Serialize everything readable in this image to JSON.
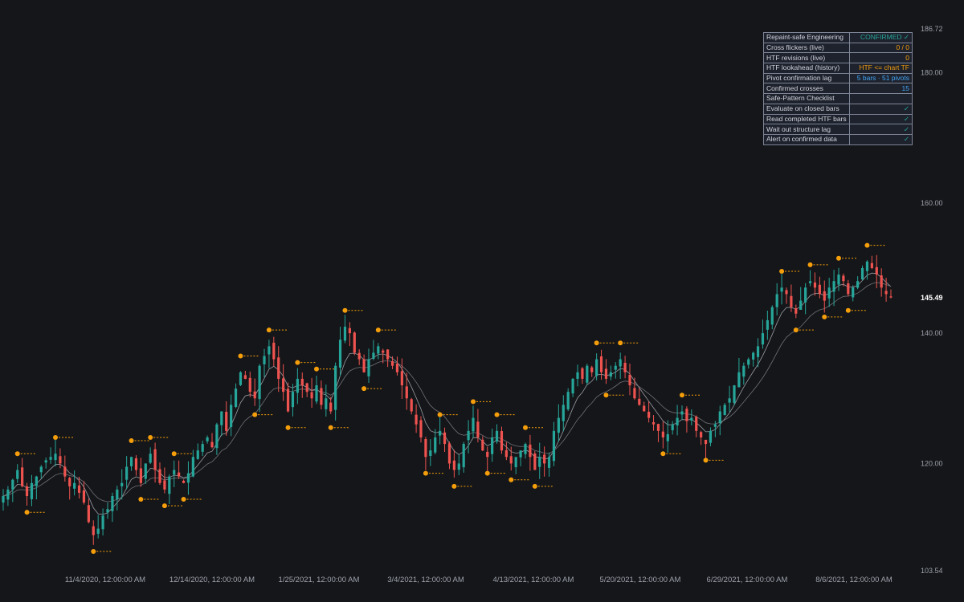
{
  "colors": {
    "background": "#151619",
    "up": "#26a69a",
    "down": "#ef5350",
    "pivot": "#f59e0b",
    "ema_fast": "#9a9ca3",
    "ema_slow": "#6f7178",
    "axis_text": "#9ba0ab",
    "last_price_text": "#ffffff"
  },
  "table": {
    "rows": [
      {
        "label": "Repaint-safe Engineering",
        "value": "CONFIRMED ✓",
        "color": "#26a69a"
      },
      {
        "label": "Cross flickers (live)",
        "value": "0 / 0",
        "color": "#f59e0b"
      },
      {
        "label": "HTF revisions (live)",
        "value": "0",
        "color": "#f59e0b"
      },
      {
        "label": "HTF lookahead (history)",
        "value": "HTF <= chart TF",
        "color": "#f59e0b"
      },
      {
        "label": "Pivot confirmation lag",
        "value": "5 bars · 51 pivots",
        "color": "#42a5f5"
      },
      {
        "label": "Confirmed crosses",
        "value": "15",
        "color": "#42a5f5"
      },
      {
        "label": "Safe-Pattern Checklist",
        "value": "",
        "color": "#d1d4dc"
      },
      {
        "label": "Evaluate on closed bars",
        "value": "✓",
        "color": "#26a69a"
      },
      {
        "label": "Read completed HTF bars",
        "value": "✓",
        "color": "#26a69a"
      },
      {
        "label": "Wait out structure lag",
        "value": "✓",
        "color": "#26a69a"
      },
      {
        "label": "Alert on confirmed data",
        "value": "✓",
        "color": "#26a69a"
      }
    ]
  },
  "chart_data": {
    "type": "candlestick",
    "ylim": [
      103.54,
      186.72
    ],
    "y_ticks": [
      "186.72",
      "180.00",
      "160.00",
      "140.00",
      "120.00",
      "103.54"
    ],
    "last_price": "145.49",
    "x_ticks": [
      "11/4/2020, 12:00:00 AM",
      "12/14/2020, 12:00:00 AM",
      "1/25/2021, 12:00:00 AM",
      "3/4/2021, 12:00:00 AM",
      "4/13/2021, 12:00:00 AM",
      "5/20/2021, 12:00:00 AM",
      "6/29/2021, 12:00:00 AM",
      "8/6/2021, 12:00:00 AM"
    ],
    "closes": [
      115,
      116,
      117.5,
      119,
      116.5,
      115,
      117,
      118,
      119.5,
      120.5,
      121,
      121.5,
      120,
      118,
      116.5,
      117,
      115.5,
      114,
      111,
      109,
      110,
      112,
      113,
      115,
      116,
      117,
      119.5,
      121,
      119,
      117,
      120,
      121.5,
      119,
      117,
      116,
      118,
      119,
      118,
      117,
      118.5,
      121,
      122,
      123,
      124,
      122.5,
      126,
      128,
      125,
      129,
      131.5,
      134,
      133,
      131,
      130,
      135,
      136.5,
      138,
      136,
      133,
      131,
      128,
      131,
      133,
      132,
      131,
      130,
      132,
      129,
      130,
      128,
      135,
      139,
      141,
      140,
      137,
      136,
      134,
      136,
      137,
      138,
      137,
      136,
      135,
      134,
      132,
      130,
      128,
      126,
      124,
      121,
      122,
      124,
      125,
      123,
      120,
      119,
      120,
      123,
      125,
      127,
      124,
      122,
      121,
      124,
      125,
      122,
      121,
      120,
      121,
      122,
      123,
      121,
      119,
      121,
      120,
      121,
      125,
      127,
      129,
      131,
      133,
      134,
      133,
      135,
      134,
      136,
      134,
      133,
      134,
      135,
      136,
      134,
      132,
      130,
      129,
      128,
      127,
      126,
      125,
      124,
      124.5,
      126,
      127,
      128,
      126.5,
      127,
      125,
      124,
      123,
      125,
      126,
      128,
      129,
      130,
      132,
      134,
      135,
      136,
      137,
      138,
      140,
      142,
      144,
      146,
      147,
      146,
      144,
      143,
      145,
      147,
      148,
      147,
      146,
      145,
      147,
      148,
      149,
      148,
      146,
      147,
      148,
      150,
      151,
      150,
      149,
      147,
      146,
      145.49
    ]
  }
}
